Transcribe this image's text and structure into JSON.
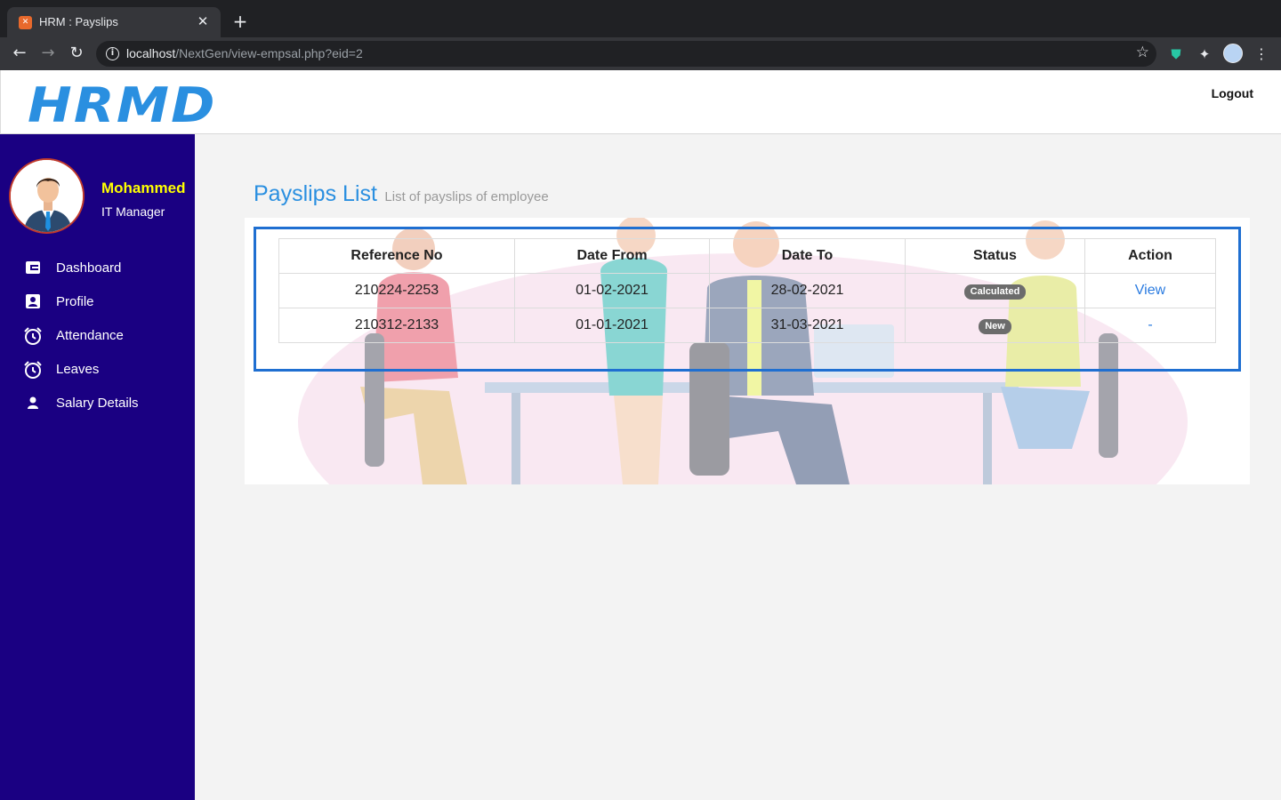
{
  "browser": {
    "tab_title": "HRM : Payslips",
    "url_host": "localhost",
    "url_path": "/NextGen/view-empsal.php?eid=2"
  },
  "header": {
    "logo": "HRMD",
    "logout_label": "Logout"
  },
  "user": {
    "name": "Mohammed",
    "role": "IT Manager"
  },
  "sidebar": {
    "items": [
      {
        "label": "Dashboard",
        "icon": "dashboard-icon"
      },
      {
        "label": "Profile",
        "icon": "profile-card-icon"
      },
      {
        "label": "Attendance",
        "icon": "alarm-clock-icon"
      },
      {
        "label": "Leaves",
        "icon": "alarm-clock-icon"
      },
      {
        "label": "Salary Details",
        "icon": "person-icon"
      }
    ]
  },
  "page": {
    "title": "Payslips List",
    "subtitle": "List of payslips of employee"
  },
  "table": {
    "headers": [
      "Reference No",
      "Date From",
      "Date To",
      "Status",
      "Action"
    ],
    "rows": [
      {
        "ref": "210224-2253",
        "from": "01-02-2021",
        "to": "28-02-2021",
        "status": "Calculated",
        "action": "View"
      },
      {
        "ref": "210312-2133",
        "from": "01-01-2021",
        "to": "31-03-2021",
        "status": "New",
        "action": "-"
      }
    ]
  },
  "colors": {
    "sidebar_bg": "#1a0082",
    "accent": "#2a8fe0",
    "user_name": "#ffff00",
    "table_border": "#1f6fd1"
  }
}
